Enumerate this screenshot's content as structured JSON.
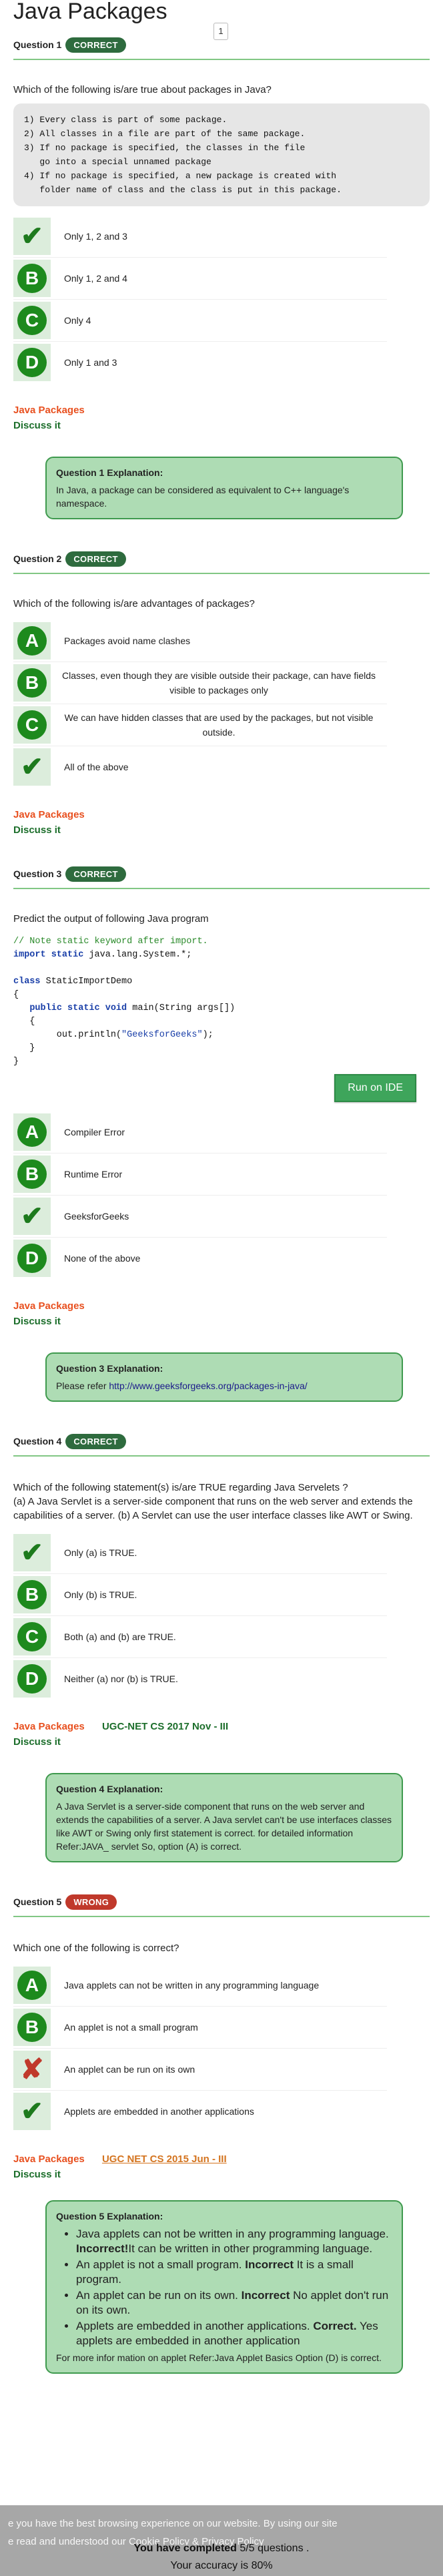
{
  "page": {
    "title": "Java Packages",
    "page_number": "1"
  },
  "colors": {
    "correct": "#2e6b3e",
    "wrong": "#c0392b",
    "accent": "#4caf50",
    "topic": "#e8501f"
  },
  "questions": [
    {
      "label": "Question 1",
      "status": "CORRECT",
      "text": "Which of the following is/are true about packages in Java?",
      "code": "1) Every class is part of some package.\n2) All classes in a file are part of the same package.\n3) If no package is specified, the classes in the file\n   go into a special unnamed package\n4) If no package is specified, a new package is created with\n   folder name of class and the class is put in this package.",
      "options": [
        {
          "mark": "check",
          "letter": "A",
          "text": "Only 1, 2 and 3"
        },
        {
          "mark": "letter",
          "letter": "B",
          "text": "Only 1, 2 and 4"
        },
        {
          "mark": "letter",
          "letter": "C",
          "text": "Only 4"
        },
        {
          "mark": "letter",
          "letter": "D",
          "text": "Only 1 and 3"
        }
      ],
      "topic": "Java Packages",
      "discuss": "Discuss it",
      "explanation_title": "Question 1 Explanation:",
      "explanation": "In Java, a package can be considered as equivalent to C++ language's namespace."
    },
    {
      "label": "Question 2",
      "status": "CORRECT",
      "text": "Which of the following is/are advantages of packages?",
      "options": [
        {
          "mark": "letter",
          "letter": "A",
          "text": "Packages avoid name clashes"
        },
        {
          "mark": "letter",
          "letter": "B",
          "text": "Classes, even though they are visible outside their package, can have fields visible to packages only"
        },
        {
          "mark": "letter",
          "letter": "C",
          "text": "We can have hidden classes that are used by the packages, but not visible outside."
        },
        {
          "mark": "check",
          "letter": "D",
          "text": "All of the above"
        }
      ],
      "topic": "Java Packages",
      "discuss": "Discuss it"
    },
    {
      "label": "Question 3",
      "status": "CORRECT",
      "text": "Predict the output of following Java program",
      "code_comment": "// Note static keyword after import.",
      "code_import_kw": "import static",
      "code_import_rest": " java.lang.System.*;",
      "code_class_kw": "class",
      "code_class_rest": " StaticImportDemo",
      "code_open": "{",
      "code_main_indent": "   ",
      "code_main_kw": "public static void",
      "code_main_rest": " main(String args[])",
      "code_inner_open": "   {",
      "code_print_pre": "        out.println(",
      "code_print_str": "\"GeeksforGeeks\"",
      "code_print_post": ");",
      "code_inner_close": "   }",
      "code_close": "}",
      "run_button": "Run on IDE",
      "options": [
        {
          "mark": "letter",
          "letter": "A",
          "text": "Compiler Error"
        },
        {
          "mark": "letter",
          "letter": "B",
          "text": "Runtime Error"
        },
        {
          "mark": "check",
          "letter": "C",
          "text": "GeeksforGeeks"
        },
        {
          "mark": "letter",
          "letter": "D",
          "text": "None of the above"
        }
      ],
      "topic": "Java Packages",
      "discuss": "Discuss it",
      "explanation_title": "Question 3 Explanation:",
      "explanation_prefix": "Please refer ",
      "explanation_link": "http://www.geeksforgeeks.org/packages-in-java/"
    },
    {
      "label": "Question 4",
      "status": "CORRECT",
      "text": "Which of the following statement(s) is/are TRUE regarding Java Servelets ?\n(a) A Java Servlet is a server-side component that runs on the web server and extends the capabilities of a server. (b) A Servlet can use the user interface classes like AWT or Swing.",
      "options": [
        {
          "mark": "check",
          "letter": "A",
          "text": "Only (a) is TRUE."
        },
        {
          "mark": "letter",
          "letter": "B",
          "text": "Only (b) is TRUE."
        },
        {
          "mark": "letter",
          "letter": "C",
          "text": "Both (a) and (b) are TRUE."
        },
        {
          "mark": "letter",
          "letter": "D",
          "text": "Neither (a) nor (b) is TRUE."
        }
      ],
      "topic": "Java Packages",
      "tag": "UGC-NET CS 2017 Nov - III",
      "discuss": "Discuss it",
      "explanation_title": "Question 4 Explanation:",
      "explanation": "A Java Servlet is a server-side component that runs on the web server and extends the capabilities of a server. A Java servlet can't be use interfaces classes like AWT or Swing only first statement is correct. for detailed information Refer:JAVA_ servlet So, option (A) is correct."
    },
    {
      "label": "Question 5",
      "status": "WRONG",
      "text": "Which one of the following is correct?",
      "options": [
        {
          "mark": "letter",
          "letter": "A",
          "text": "Java applets can not be written in any programming language"
        },
        {
          "mark": "letter",
          "letter": "B",
          "text": "An applet is not a small program"
        },
        {
          "mark": "cross",
          "letter": "C",
          "text": "An applet can be run on its own"
        },
        {
          "mark": "check",
          "letter": "D",
          "text": "Applets are embedded in another applications"
        }
      ],
      "topic": "Java Packages",
      "tag": "UGC NET CS 2015 Jun - III",
      "discuss": "Discuss it",
      "explanation_title": "Question 5 Explanation:",
      "bullets": [
        {
          "text": "Java applets can not be written in any programming language. ",
          "verdict": "Incorrect!",
          "tail": "It can be written in other programming language."
        },
        {
          "text": "An applet is not a small program. ",
          "verdict": "Incorrect",
          "tail": " It is a small program."
        },
        {
          "text": "An applet can be run on its own. ",
          "verdict": "Incorrect",
          "tail": " No applet don't run on its own."
        },
        {
          "text": "Applets are embedded in another applications. ",
          "verdict": "Correct.",
          "tail": " Yes applets are embedded in another application"
        }
      ],
      "explanation_footer": "For more infor mation on applet Refer:Java Applet Basics Option (D) is correct."
    }
  ],
  "cookie_bar": {
    "line1": "e you have the best browsing experience on our website. By using our site",
    "line2": "e read and understood our Cookie Policy & Privacy Policy",
    "score_prefix": "You have completed ",
    "score_value": "5/5",
    "score_suffix": " questions .",
    "accuracy_prefix": "Your accuracy is ",
    "accuracy_value": "80%"
  }
}
